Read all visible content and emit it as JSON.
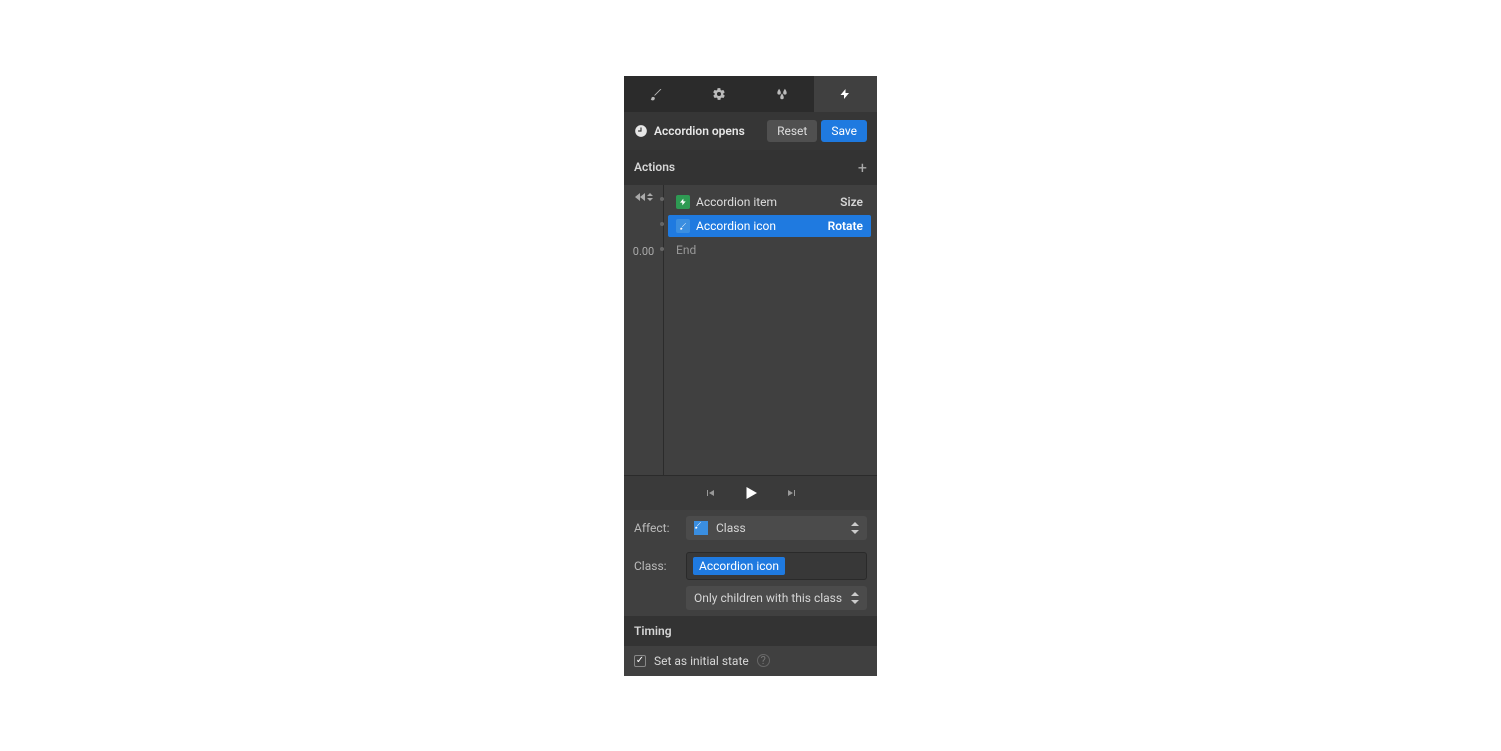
{
  "header": {
    "title": "Accordion opens",
    "reset_label": "Reset",
    "save_label": "Save"
  },
  "actions": {
    "header": "Actions",
    "rows": [
      {
        "name": "Accordion item",
        "prop": "Size"
      },
      {
        "name": "Accordion icon",
        "prop": "Rotate"
      }
    ],
    "end_time": "0.00",
    "end_label": "End"
  },
  "affect": {
    "label": "Affect:",
    "value": "Class"
  },
  "class": {
    "label": "Class:",
    "chip": "Accordion icon",
    "scope": "Only children with this class"
  },
  "timing": {
    "header": "Timing",
    "initial_state_label": "Set as initial state",
    "initial_state_checked": true
  }
}
